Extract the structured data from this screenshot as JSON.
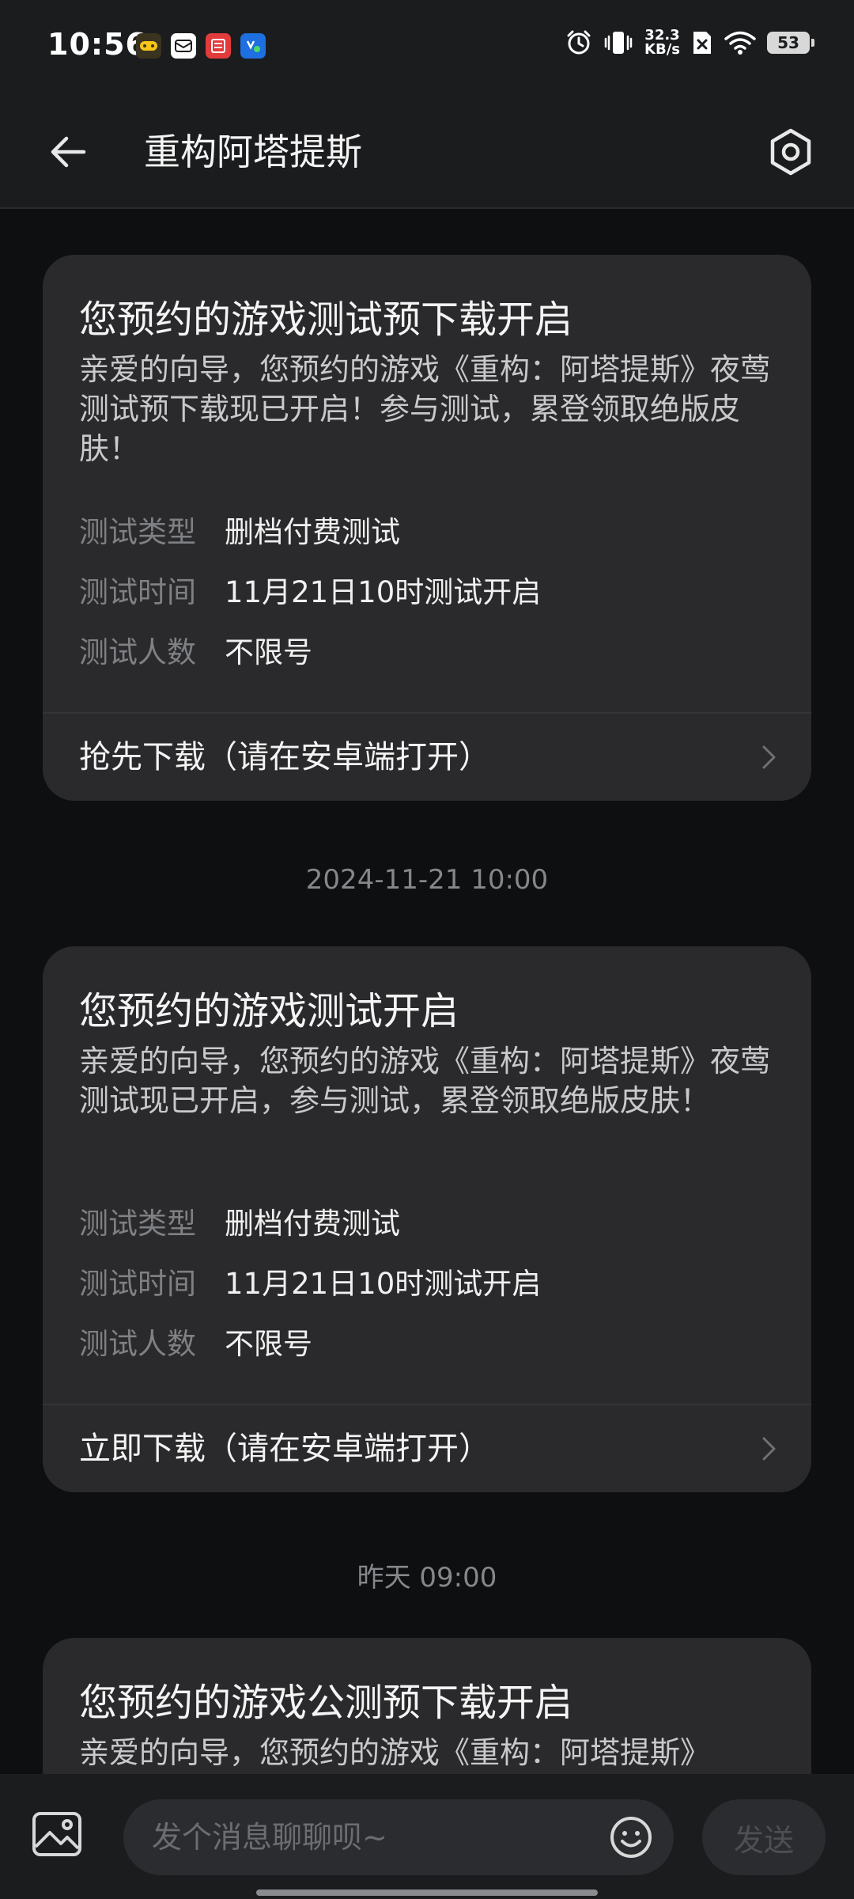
{
  "status_bar": {
    "time": "10:56",
    "net_speed_value": "32.3",
    "net_speed_unit": "KB/s",
    "battery": "53"
  },
  "header": {
    "title": "重构阿塔提斯"
  },
  "messages": [
    {
      "title": "您预约的游戏测试预下载开启",
      "body": "亲爱的向导，您预约的游戏《重构：阿塔提斯》夜莺测试预下载现已开启！参与测试，累登领取绝版皮肤！",
      "info": [
        {
          "label": "测试类型",
          "value": "删档付费测试"
        },
        {
          "label": "测试时间",
          "value": "11月21日10时测试开启"
        },
        {
          "label": "测试人数",
          "value": "不限号"
        }
      ],
      "action": "抢先下载（请在安卓端打开）"
    },
    {
      "timestamp": "2024-11-21 10:00",
      "title": "您预约的游戏测试开启",
      "body": "亲爱的向导，您预约的游戏《重构：阿塔提斯》夜莺测试现已开启，参与测试，累登领取绝版皮肤！",
      "info": [
        {
          "label": "测试类型",
          "value": "删档付费测试"
        },
        {
          "label": "测试时间",
          "value": "11月21日10时测试开启"
        },
        {
          "label": "测试人数",
          "value": "不限号"
        }
      ],
      "action": "立即下载（请在安卓端打开）"
    },
    {
      "timestamp": "昨天 09:00",
      "title": "您预约的游戏公测预下载开启",
      "body": "亲爱的向导，您预约的游戏《重构：阿塔提斯》"
    }
  ],
  "input_bar": {
    "placeholder": "发个消息聊聊呗~",
    "send_label": "发送"
  },
  "icons": {
    "back": "arrow-left-icon",
    "settings": "hexagon-gear-icon",
    "image": "image-icon",
    "emoji": "smiley-icon",
    "chevron": "chevron-right-icon"
  }
}
